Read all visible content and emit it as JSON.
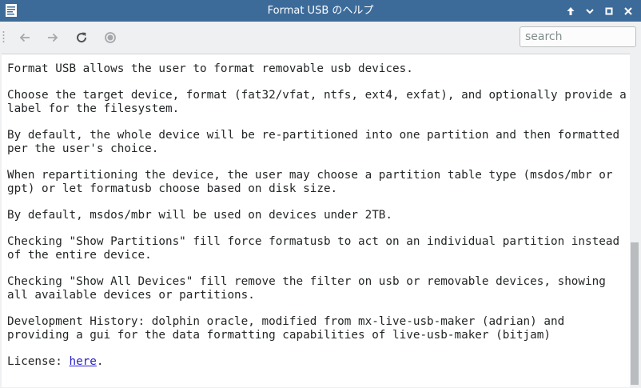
{
  "window": {
    "title": "Format USB のヘルプ"
  },
  "toolbar": {
    "back_icon": "arrow-left-icon",
    "forward_icon": "arrow-right-icon",
    "reload_icon": "reload-icon",
    "stop_icon": "stop-icon",
    "search_placeholder": "search"
  },
  "content": {
    "paragraphs": [
      "Format USB allows the user to format removable usb devices.",
      "Choose the target device, format (fat32/vfat, ntfs, ext4, exfat), and optionally provide a label for the filesystem.",
      "By default, the whole device will be re-partitioned into one partition and then formatted per the user's choice.",
      "When repartitioning the device, the user may choose a partition table type (msdos/mbr or gpt) or let formatusb choose based on disk size.",
      "By default, msdos/mbr will be used on devices under 2TB.",
      "Checking \"Show Partitions\" fill force formatusb to act on an individual partition instead of the entire device.",
      "Checking \"Show All Devices\" fill remove the filter on usb or removable devices, showing all available devices or partitions.",
      "Development History: dolphin oracle, modified from mx-live-usb-maker (adrian) and providing a gui for the data formatting capabilities of live-usb-maker (bitjam)"
    ],
    "license_label": "License: ",
    "license_link": "here",
    "license_end": "."
  },
  "colors": {
    "titlebar": "#3c6b9a",
    "link": "#2c20c9"
  }
}
